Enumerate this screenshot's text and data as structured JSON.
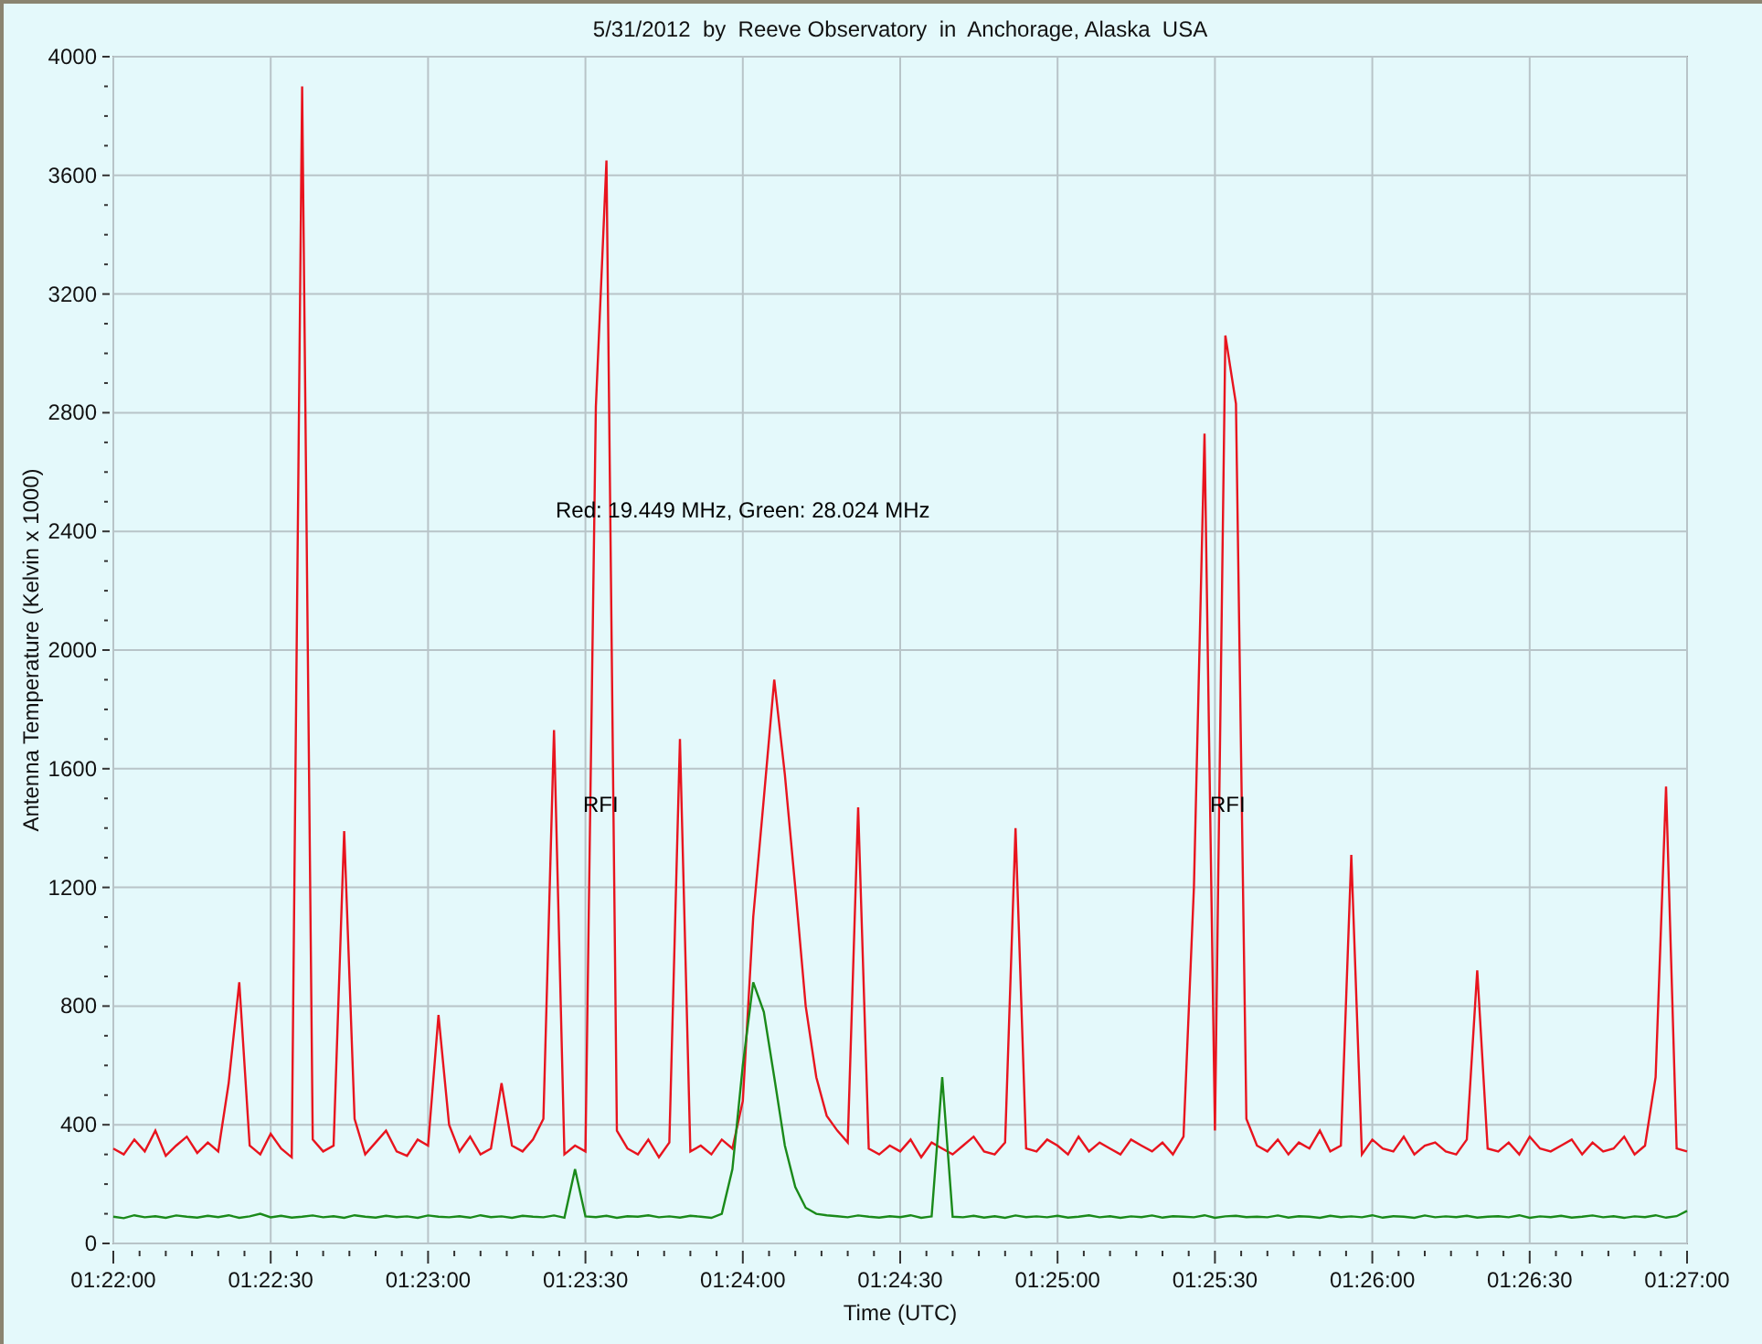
{
  "chart_data": {
    "type": "line",
    "title": "5/31/2012  by  Reeve Observatory  in  Anchorage, Alaska  USA",
    "xlabel": "Time (UTC)",
    "ylabel": "Antenna Temperature (Kelvin x 1000)",
    "categories": [
      "01:22:00",
      null,
      null,
      null,
      null,
      null,
      null,
      null,
      null,
      null,
      null,
      null,
      null,
      null,
      null,
      "01:22:30",
      null,
      null,
      null,
      null,
      null,
      null,
      null,
      null,
      null,
      null,
      null,
      null,
      null,
      null,
      "01:23:00",
      null,
      null,
      null,
      null,
      null,
      null,
      null,
      null,
      null,
      null,
      null,
      null,
      null,
      null,
      "01:23:30",
      null,
      null,
      null,
      null,
      null,
      null,
      null,
      null,
      null,
      null,
      null,
      null,
      null,
      null,
      "01:24:00",
      null,
      null,
      null,
      null,
      null,
      null,
      null,
      null,
      null,
      null,
      null,
      null,
      null,
      null,
      "01:24:30",
      null,
      null,
      null,
      null,
      null,
      null,
      null,
      null,
      null,
      null,
      null,
      null,
      null,
      null,
      "01:25:00",
      null,
      null,
      null,
      null,
      null,
      null,
      null,
      null,
      null,
      null,
      null,
      null,
      null,
      null,
      "01:25:30",
      null,
      null,
      null,
      null,
      null,
      null,
      null,
      null,
      null,
      null,
      null,
      null,
      null,
      null,
      "01:26:00",
      null,
      null,
      null,
      null,
      null,
      null,
      null,
      null,
      null,
      null,
      null,
      null,
      null,
      null,
      "01:26:30",
      null,
      null,
      null,
      null,
      null,
      null,
      null,
      null,
      null,
      null,
      null,
      null,
      null,
      null,
      "01:27:00"
    ],
    "series": [
      {
        "color": "#e8141e",
        "values": [
          320,
          300,
          350,
          310,
          380,
          295,
          330,
          360,
          305,
          340,
          310,
          540,
          880,
          330,
          300,
          370,
          320,
          290,
          3900,
          350,
          310,
          330,
          1390,
          420,
          300,
          340,
          380,
          310,
          295,
          350,
          330,
          770,
          400,
          310,
          360,
          300,
          320,
          540,
          330,
          310,
          350,
          420,
          1730,
          300,
          330,
          310,
          2820,
          3650,
          380,
          320,
          300,
          350,
          290,
          340,
          1700,
          310,
          330,
          300,
          350,
          320,
          480,
          1100,
          1500,
          1900,
          1580,
          1200,
          800,
          560,
          430,
          380,
          340,
          1470,
          320,
          300,
          330,
          310,
          350,
          290,
          340,
          320,
          300,
          330,
          360,
          310,
          300,
          340,
          1400,
          320,
          310,
          350,
          330,
          300,
          360,
          310,
          340,
          320,
          300,
          350,
          330,
          310,
          340,
          300,
          360,
          1200,
          2730,
          380,
          3060,
          2830,
          420,
          330,
          310,
          350,
          300,
          340,
          320,
          380,
          310,
          330,
          1310,
          300,
          350,
          320,
          310,
          360,
          300,
          330,
          340,
          310,
          300,
          350,
          920,
          320,
          310,
          340,
          300,
          360,
          320,
          310,
          330,
          350,
          300,
          340,
          310,
          320,
          360,
          300,
          330,
          560,
          1540,
          320,
          310
        ]
      },
      {
        "color": "#1a8a1a",
        "values": [
          90,
          85,
          95,
          88,
          92,
          86,
          94,
          90,
          87,
          93,
          89,
          95,
          86,
          91,
          100,
          88,
          93,
          87,
          90,
          94,
          88,
          92,
          86,
          95,
          90,
          87,
          93,
          89,
          91,
          86,
          94,
          90,
          88,
          92,
          87,
          95,
          89,
          91,
          86,
          93,
          90,
          88,
          94,
          87,
          250,
          91,
          89,
          93,
          86,
          92,
          90,
          95,
          88,
          91,
          87,
          93,
          90,
          86,
          100,
          250,
          600,
          880,
          780,
          560,
          330,
          190,
          120,
          100,
          95,
          92,
          88,
          94,
          90,
          87,
          92,
          89,
          95,
          86,
          91,
          560,
          90,
          88,
          93,
          87,
          92,
          86,
          94,
          89,
          91,
          88,
          93,
          87,
          90,
          95,
          88,
          92,
          86,
          91,
          89,
          94,
          87,
          92,
          90,
          88,
          95,
          86,
          91,
          93,
          89,
          90,
          88,
          94,
          87,
          92,
          90,
          86,
          93,
          89,
          91,
          88,
          95,
          87,
          92,
          90,
          86,
          94,
          88,
          91,
          89,
          93,
          87,
          90,
          92,
          88,
          95,
          86,
          91,
          89,
          93,
          87,
          90,
          94,
          88,
          92,
          86,
          91,
          89,
          95,
          87,
          92,
          110
        ]
      }
    ],
    "ylim": [
      0,
      4000
    ],
    "grid": true,
    "yticks": [
      0,
      400,
      800,
      1200,
      1600,
      2000,
      2400,
      2800,
      3200,
      3600,
      4000
    ],
    "annotations": [
      "Red: 19.449 MHz, Green: 28.024 MHz",
      "RFI",
      "RFI"
    ]
  }
}
